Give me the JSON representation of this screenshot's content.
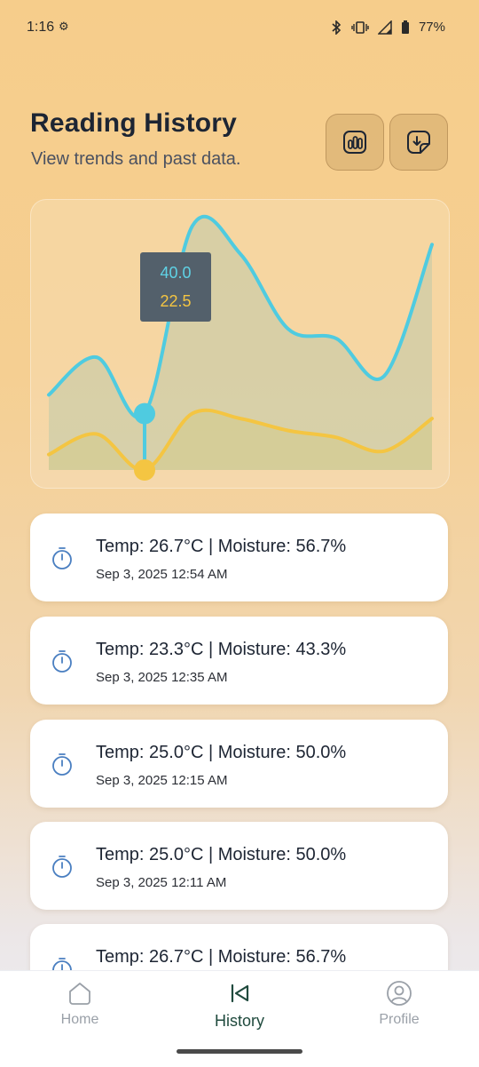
{
  "status_bar": {
    "time": "1:16",
    "battery": "77%"
  },
  "header": {
    "title": "Reading History",
    "subtitle": "View trends and past data."
  },
  "chart_data": {
    "type": "area",
    "x": [
      0,
      1,
      2,
      3,
      4,
      5,
      6,
      7,
      8
    ],
    "series": [
      {
        "values": [
          42,
          46,
          40,
          60,
          57,
          49,
          48,
          44,
          58
        ],
        "color": "#4fcbe0"
      },
      {
        "values": [
          23.4,
          24.6,
          22.5,
          25.8,
          25.5,
          24.8,
          24.4,
          23.6,
          25.5
        ],
        "color": "#f4c542"
      }
    ],
    "tooltip": {
      "value_1": "40.0",
      "value_2": "22.5",
      "selected_index": 2
    },
    "grid": false
  },
  "readings": [
    {
      "text": "Temp: 26.7°C | Moisture: 56.7%",
      "date": "Sep 3, 2025 12:54 AM"
    },
    {
      "text": "Temp: 23.3°C | Moisture: 43.3%",
      "date": "Sep 3, 2025 12:35 AM"
    },
    {
      "text": "Temp: 25.0°C | Moisture: 50.0%",
      "date": "Sep 3, 2025 12:15 AM"
    },
    {
      "text": "Temp: 25.0°C | Moisture: 50.0%",
      "date": "Sep 3, 2025 12:11 AM"
    },
    {
      "text": "Temp: 26.7°C | Moisture: 56.7%",
      "date": ""
    }
  ],
  "nav": {
    "home": "Home",
    "history": "History",
    "profile": "Profile"
  },
  "colors": {
    "accent": "#1f4a3d",
    "timer_icon": "#4a7fc1"
  }
}
